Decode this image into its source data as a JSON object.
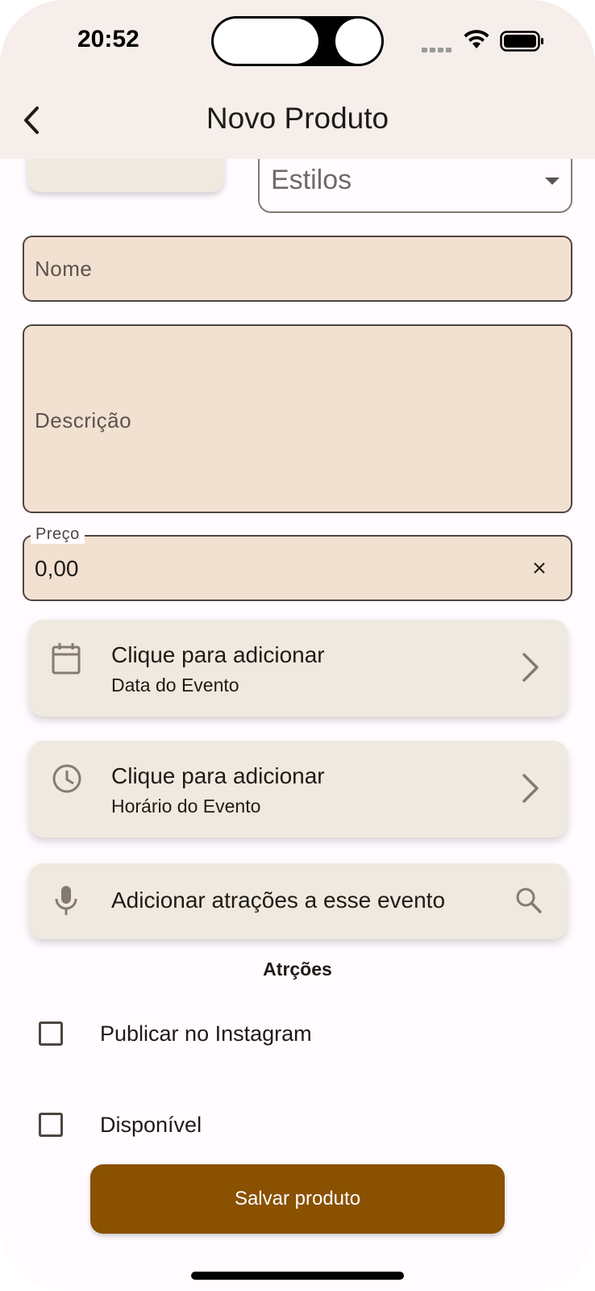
{
  "status_bar": {
    "time": "20:52"
  },
  "app_bar": {
    "title": "Novo Produto",
    "back_icon": "chevron-left-icon"
  },
  "form": {
    "estilos_dropdown": {
      "label": "Estilos"
    },
    "nome_field": {
      "placeholder": "Nome",
      "value": ""
    },
    "descricao_field": {
      "placeholder": "Descrição",
      "value": ""
    },
    "preco_field": {
      "label": "Preço",
      "value": "0,00"
    }
  },
  "date_card": {
    "title": "Clique para adicionar",
    "subtitle": "Data do Evento",
    "icon": "calendar-icon"
  },
  "time_card": {
    "title": "Clique para adicionar",
    "subtitle": "Horário do Evento",
    "icon": "clock-icon"
  },
  "attractions_search": {
    "placeholder": "Adicionar atrações a esse evento",
    "icons": [
      "mic-icon",
      "search-icon"
    ]
  },
  "attractions_section": {
    "title": "Atrções"
  },
  "checkboxes": [
    {
      "label": "Publicar no Instagram",
      "checked": false
    },
    {
      "label": "Disponível",
      "checked": false
    }
  ],
  "save_button": {
    "label": "Salvar produto"
  },
  "colors": {
    "app_bar_bg": "#f5eeea",
    "field_bg": "#f2e1d1",
    "card_bg": "#f0e9df",
    "primary": "#8a5100"
  }
}
